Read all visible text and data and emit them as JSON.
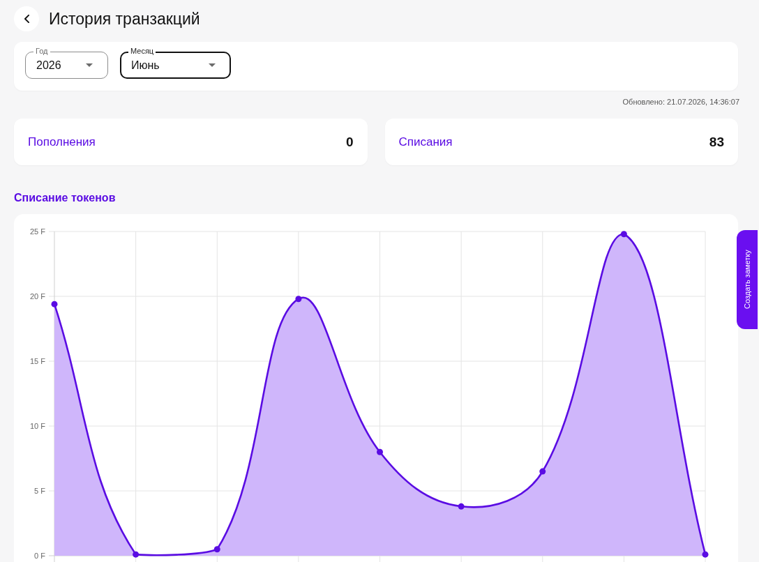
{
  "header": {
    "title": "История транзакций"
  },
  "filters": [
    {
      "label": "Год",
      "value": "2026",
      "focused": false
    },
    {
      "label": "Месяц",
      "value": "Июнь",
      "focused": true
    }
  ],
  "updated": "Обновлено: 21.07.2026, 14:36:07",
  "stats": [
    {
      "label": "Пополнения",
      "value": "0"
    },
    {
      "label": "Списания",
      "value": "83"
    }
  ],
  "chart_section": {
    "title": "Списание токенов",
    "chart_data": {
      "type": "area",
      "values": [
        19.4,
        0.1,
        0.5,
        19.8,
        8.0,
        3.8,
        6.5,
        24.8,
        0.1
      ],
      "ylim": [
        0,
        25
      ],
      "yticks": [
        {
          "value": 0,
          "label": "0 F"
        },
        {
          "value": 5,
          "label": "5 F"
        },
        {
          "value": 10,
          "label": "10 F"
        },
        {
          "value": 15,
          "label": "15 F"
        },
        {
          "value": 20,
          "label": "20 F"
        },
        {
          "value": 25,
          "label": "25 F"
        }
      ],
      "grid": true
    }
  },
  "side_button": {
    "label": "Создать заметку"
  }
}
